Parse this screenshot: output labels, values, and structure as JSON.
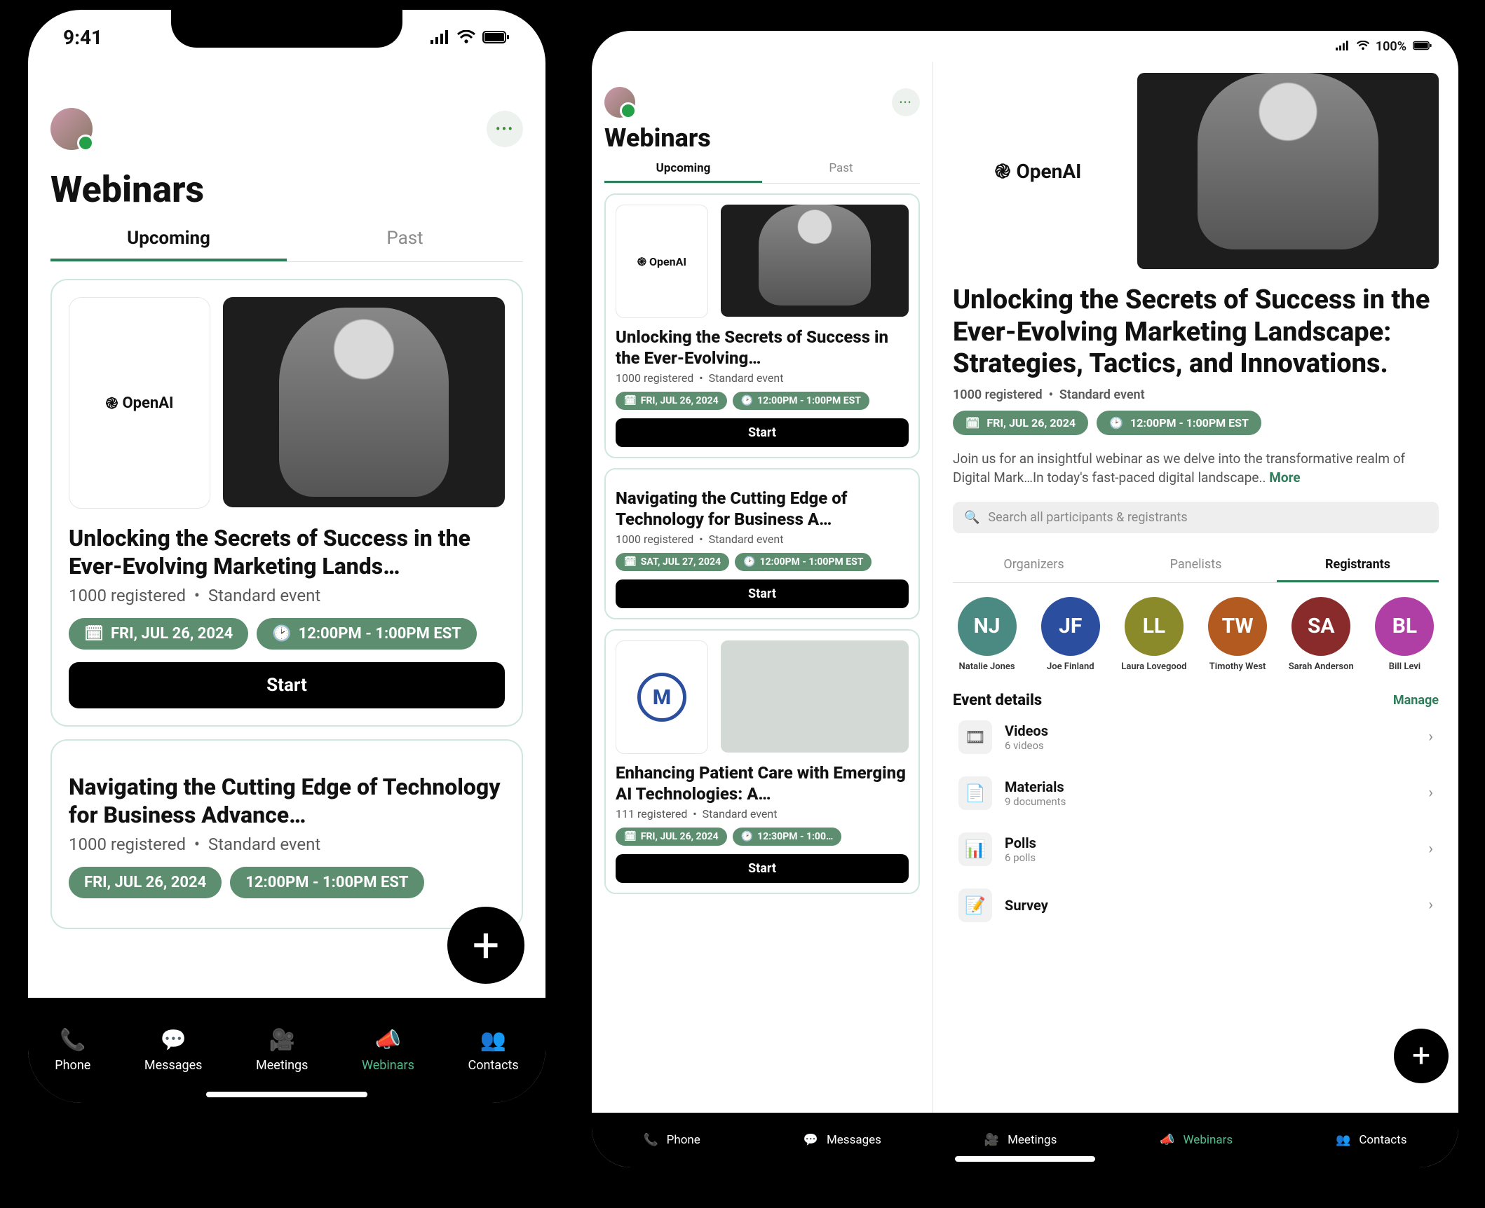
{
  "phone": {
    "status": {
      "time": "9:41"
    },
    "page_title": "Webinars",
    "tabs": {
      "upcoming": "Upcoming",
      "past": "Past",
      "active": "upcoming"
    },
    "cards": [
      {
        "logo_text": "OpenAI",
        "title": "Unlocking the Secrets of Success in the Ever-Evolving Marketing Lands…",
        "registered": "1000 registered",
        "kind": "Standard event",
        "date": "FRI, JUL 26, 2024",
        "time": "12:00PM - 1:00PM EST",
        "cta": "Start"
      },
      {
        "title": "Navigating the Cutting Edge of Technology for Business Advance…",
        "registered": "1000 registered",
        "kind": "Standard event",
        "date": "FRI, JUL 26, 2024",
        "time": "12:00PM - 1:00PM EST"
      }
    ],
    "nav": {
      "phone": "Phone",
      "messages": "Messages",
      "meetings": "Meetings",
      "webinars": "Webinars",
      "contacts": "Contacts",
      "active": "webinars"
    }
  },
  "tablet": {
    "status": {
      "battery": "100%"
    },
    "page_title": "Webinars",
    "tabs": {
      "upcoming": "Upcoming",
      "past": "Past",
      "active": "upcoming"
    },
    "cards": [
      {
        "logo_text": "OpenAI",
        "title": "Unlocking the Secrets of Success in the Ever-Evolving…",
        "registered": "1000 registered",
        "kind": "Standard event",
        "date": "FRI, JUL 26, 2024",
        "time": "12:00PM - 1:00PM EST",
        "cta": "Start"
      },
      {
        "title": "Navigating the Cutting Edge of Technology for Business A…",
        "registered": "1000 registered",
        "kind": "Standard event",
        "date": "SAT, JUL 27, 2024",
        "time": "12:00PM - 1:00PM EST",
        "cta": "Start"
      },
      {
        "title": "Enhancing Patient Care with Emerging AI Technologies: A…",
        "registered": "111 registered",
        "kind": "Standard event",
        "date": "FRI, JUL 26, 2024",
        "time": "12:30PM - 1:00…",
        "cta": "Start"
      }
    ],
    "detail": {
      "logo_text": "OpenAI",
      "title": "Unlocking the Secrets of Success in the Ever-Evolving Marketing Landscape: Strategies, Tactics, and Innovations.",
      "registered": "1000 registered",
      "kind": "Standard event",
      "date": "FRI, JUL 26, 2024",
      "time": "12:00PM - 1:00PM EST",
      "desc": "Join us for an insightful webinar as we delve into the transformative realm of Digital Mark…In today's fast-paced digital landscape.. ",
      "more": "More",
      "search_placeholder": "Search all participants & registrants",
      "ptabs": {
        "organizers": "Organizers",
        "panelists": "Panelists",
        "registrants": "Registrants",
        "active": "registrants"
      },
      "people": [
        {
          "initials": "NJ",
          "name": "Natalie Jones",
          "color": "#4a8a82"
        },
        {
          "initials": "JF",
          "name": "Joe Finland",
          "color": "#2b4f9e"
        },
        {
          "initials": "LL",
          "name": "Laura Lovegood",
          "color": "#8a8a2b"
        },
        {
          "initials": "TW",
          "name": "Timothy West",
          "color": "#b35a20"
        },
        {
          "initials": "SA",
          "name": "Sarah Anderson",
          "color": "#8a2b2b"
        },
        {
          "initials": "BL",
          "name": "Bill Levi",
          "color": "#b03fa5"
        }
      ],
      "event_details_title": "Event details",
      "manage": "Manage",
      "items": [
        {
          "title": "Videos",
          "sub": "6 videos"
        },
        {
          "title": "Materials",
          "sub": "9 documents"
        },
        {
          "title": "Polls",
          "sub": "6 polls"
        },
        {
          "title": "Survey",
          "sub": ""
        }
      ]
    },
    "nav": {
      "phone": "Phone",
      "messages": "Messages",
      "meetings": "Meetings",
      "webinars": "Webinars",
      "contacts": "Contacts",
      "active": "webinars"
    }
  }
}
